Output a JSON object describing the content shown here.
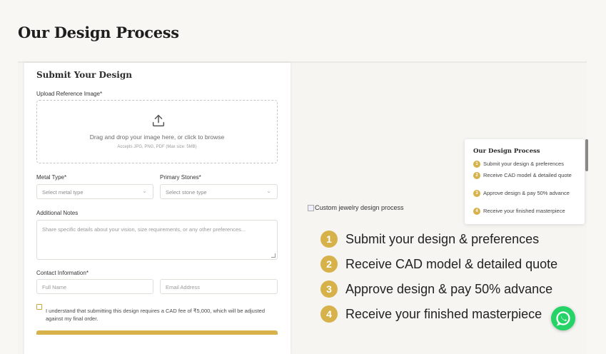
{
  "page_title": "Our Design Process",
  "form": {
    "title": "Submit Your Design",
    "upload": {
      "label": "Upload Reference Image*",
      "icon": "upload-icon",
      "text": "Drag and drop your image here, or click to browse",
      "hint": "Accepts JPG, PNG, PDF (Max size: 5MB)"
    },
    "metal": {
      "label": "Metal Type*",
      "placeholder": "Select metal type"
    },
    "stones": {
      "label": "Primary Stones*",
      "placeholder": "Select stone type"
    },
    "notes": {
      "label": "Additional Notes",
      "placeholder": "Share specific details about your vision, size requirements, or any other preferences..."
    },
    "contact": {
      "label": "Contact Information*",
      "name_placeholder": "Full Name",
      "email_placeholder": "Email Address"
    },
    "terms": "I understand that submitting this design requires a CAD fee of ₹5,000, which will be adjusted against my final order."
  },
  "process_image_alt": "Custom jewelry design process",
  "popup": {
    "title": "Our Design Process",
    "steps": [
      {
        "num": "1",
        "text": "Submit your design & preferences"
      },
      {
        "num": "2",
        "text": "Receive CAD model & detailed quote"
      },
      {
        "num": "3",
        "text": "Approve design & pay 50% advance"
      },
      {
        "num": "4",
        "text": "Receive your finished masterpiece"
      }
    ]
  },
  "steps": [
    {
      "num": "1",
      "text": "Submit your design & preferences"
    },
    {
      "num": "2",
      "text": "Receive CAD model & detailed quote"
    },
    {
      "num": "3",
      "text": "Approve design & pay 50% advance"
    },
    {
      "num": "4",
      "text": "Receive your finished masterpiece"
    }
  ],
  "colors": {
    "accent": "#d7b24a",
    "whatsapp": "#25d366",
    "background": "#f8f7f4"
  },
  "whatsapp_icon": "whatsapp-icon"
}
